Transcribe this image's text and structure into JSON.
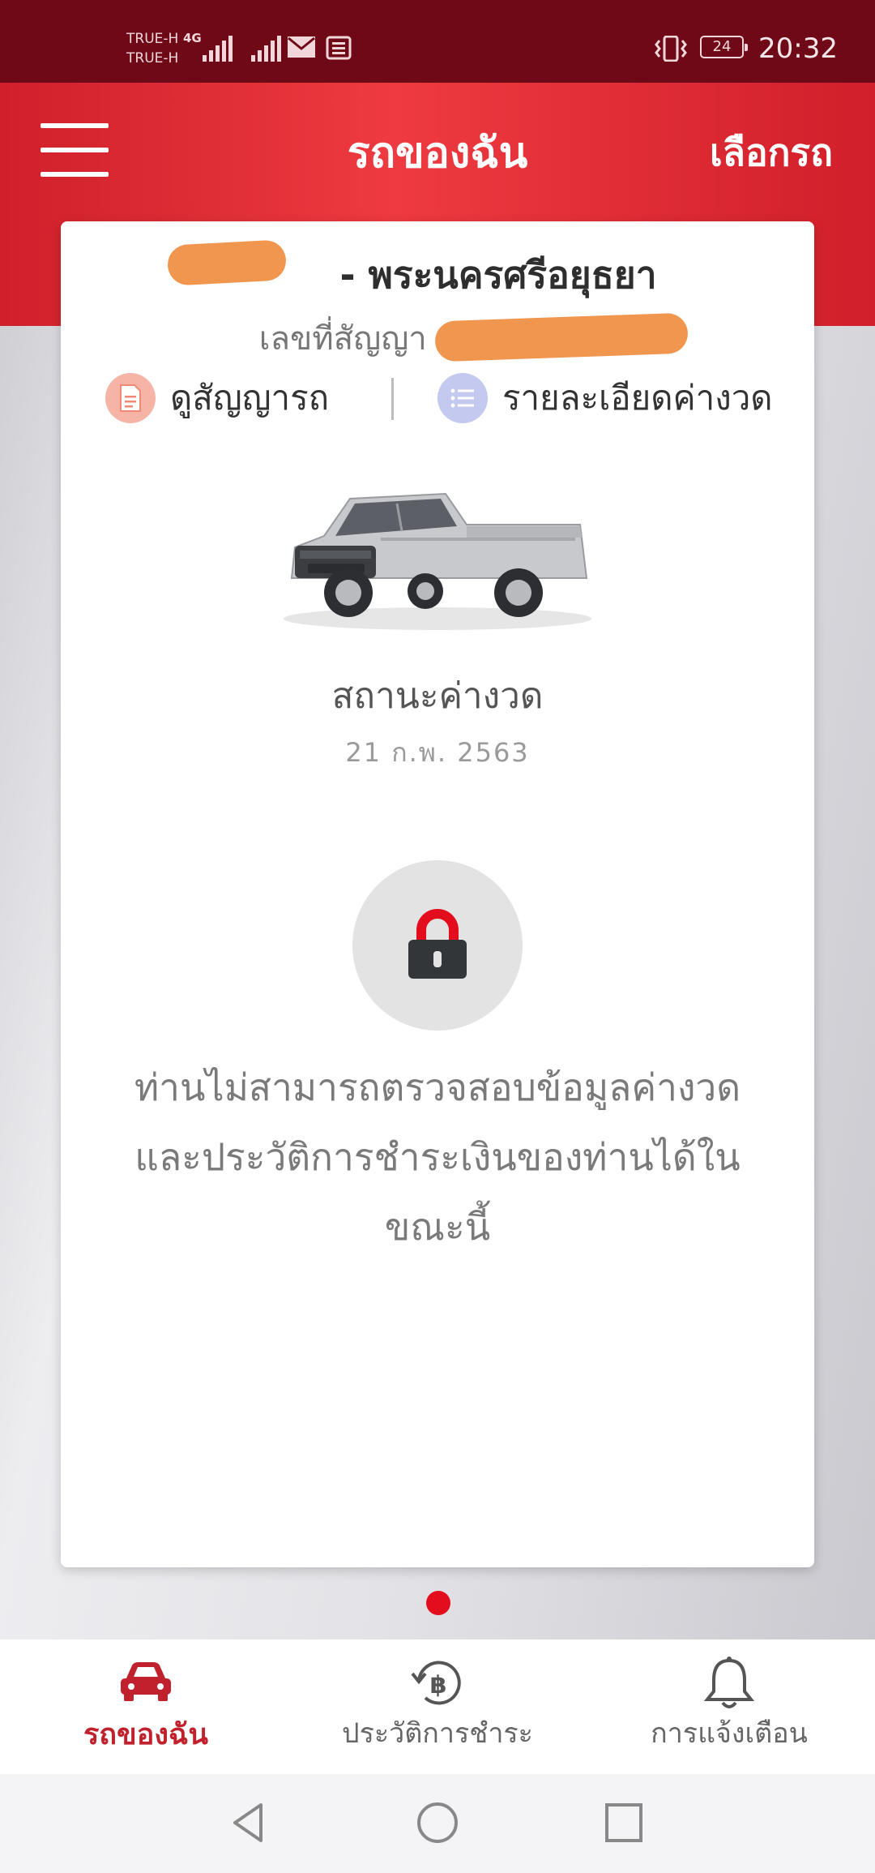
{
  "status_bar": {
    "carrier_1": "TRUE-H",
    "carrier_2": "TRUE-H",
    "network_type": "4G",
    "battery_level": "24",
    "time": "20:32"
  },
  "app_bar": {
    "title": "รถของฉัน",
    "select_car_label": "เลือกรถ"
  },
  "car_card": {
    "province_suffix": "- พระนครศรีอยุธยา",
    "contract_label": "เลขที่สัญญา :",
    "view_contract_label": "ดูสัญญารถ",
    "installment_detail_label": "รายละเอียดค่างวด",
    "status_title": "สถานะค่างวด",
    "status_date": "21 ก.พ. 2563",
    "locked_message": "ท่านไม่สามารถตรวจสอบข้อมูลค่างวด และประวัติการชำระเงินของท่านได้ในขณะนี้"
  },
  "pager": {
    "total_pages": 1,
    "active_index": 0
  },
  "tab_bar": {
    "tabs": [
      {
        "label": "รถของฉัน",
        "icon": "car-icon",
        "active": true
      },
      {
        "label": "ประวัติการชำระ",
        "icon": "payment-history-icon",
        "active": false
      },
      {
        "label": "การแจ้งเตือน",
        "icon": "bell-icon",
        "active": false
      }
    ]
  },
  "colors": {
    "status_bar": "#6f0917",
    "brand_red": "#e0282f",
    "active_tab": "#c0212c",
    "redaction": "#f0964f"
  }
}
